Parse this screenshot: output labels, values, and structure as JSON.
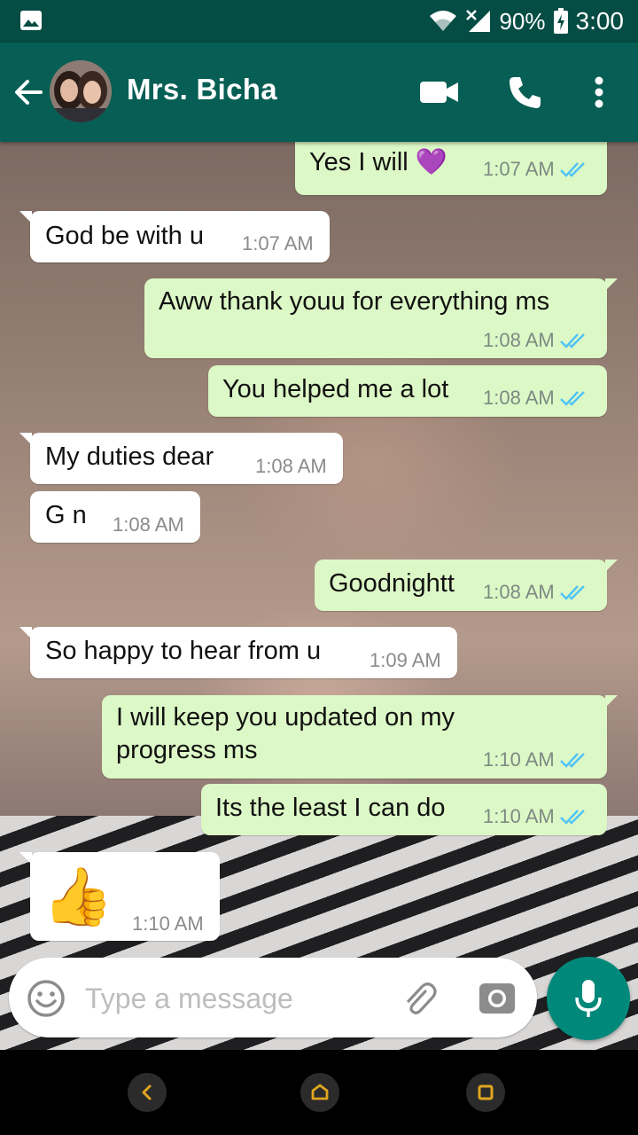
{
  "status_bar": {
    "battery": "90%",
    "time": "3:00"
  },
  "header": {
    "contact_name": "Mrs. Bicha"
  },
  "messages": [
    {
      "dir": "out",
      "text": "Yes I will 💜",
      "time": "1:07 AM"
    },
    {
      "dir": "in",
      "text": "God be with u",
      "time": "1:07 AM"
    },
    {
      "dir": "out",
      "text": "Aww thank youu for everything ms",
      "time": "1:08 AM"
    },
    {
      "dir": "out",
      "text": "You helped me a lot",
      "time": "1:08 AM"
    },
    {
      "dir": "in",
      "text": "My duties dear",
      "time": "1:08 AM"
    },
    {
      "dir": "in",
      "text": "G n",
      "time": "1:08 AM"
    },
    {
      "dir": "out",
      "text": "Goodnightt",
      "time": "1:08 AM"
    },
    {
      "dir": "in",
      "text": "So happy to hear from u",
      "time": "1:09 AM"
    },
    {
      "dir": "out",
      "text": "I will keep you updated on my",
      "text2": "progress ms",
      "time": "1:10 AM"
    },
    {
      "dir": "out",
      "text": "Its the least I can do",
      "time": "1:10 AM"
    },
    {
      "dir": "in",
      "text": "👍",
      "time": "1:10 AM"
    }
  ],
  "composer": {
    "placeholder": "Type a message"
  },
  "colors": {
    "header": "#075e54",
    "statusbar": "#054d44",
    "outgoing": "#dcf8c6",
    "incoming": "#ffffff",
    "mic": "#00897b",
    "read_ticks": "#4fc3f7"
  }
}
